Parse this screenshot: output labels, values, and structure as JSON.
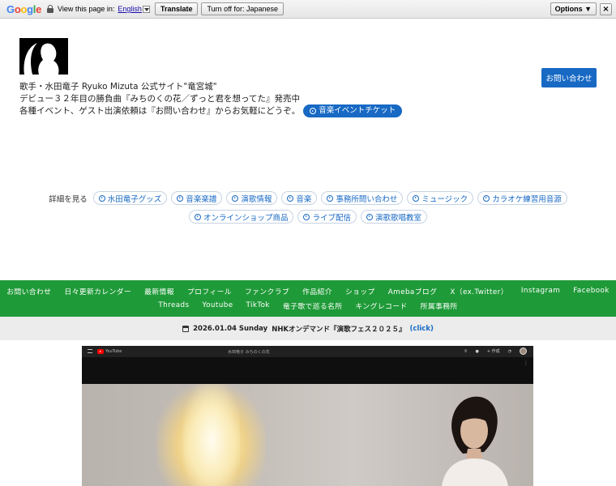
{
  "translate_bar": {
    "logo": "Google",
    "view_label": "View this page in:",
    "language": "English",
    "translate_btn": "Translate",
    "turn_off_btn": "Turn off for: Japanese",
    "options_btn": "Options ▼",
    "close_btn": "×"
  },
  "header": {
    "line1": "歌手・水田竜子 Ryuko Mizuta 公式サイト\"竜宮城\"",
    "line2": "デビュー３２年目の勝負曲『みちのくの花／ずっと君を想ってた』発売中",
    "line3": "各種イベント、ゲスト出演依頼は『お問い合わせ』からお気軽にどうぞ。",
    "ticket_btn": "音楽イベントチケット",
    "contact_btn": "お問い合わせ"
  },
  "details": {
    "label": "詳細を見る",
    "row1": [
      "水田竜子グッズ",
      "音楽楽譜",
      "演歌情報",
      "音楽",
      "事務所問い合わせ",
      "ミュージック",
      "カラオケ練習用音源"
    ],
    "row2": [
      "オンラインショップ商品",
      "ライブ配信",
      "演歌歌唱教室"
    ]
  },
  "nav": {
    "row1": [
      "お問い合わせ",
      "日々更新カレンダー",
      "最新情報",
      "プロフィール",
      "ファンクラブ",
      "作品紹介",
      "ショップ",
      "Amebaブログ",
      "X（ex.Twitter）",
      "Instagram",
      "Facebook"
    ],
    "row2": [
      "Threads",
      "Youtube",
      "TikTok",
      "竜子歌で巡る名所",
      "キングレコード",
      "所属事務所"
    ]
  },
  "datebar": {
    "date": "2026.01.04 Sunday",
    "headline": "NHKオンデマンド『演歌フェス２０２５』",
    "click": "(click)"
  },
  "video": {
    "brand": "YouTube",
    "title": "水田竜子 みちのくの花",
    "create": "+ 作成"
  },
  "colors": {
    "accent": "#1769c4",
    "nav_green": "#1f9a38",
    "date_bg": "#ececec"
  }
}
